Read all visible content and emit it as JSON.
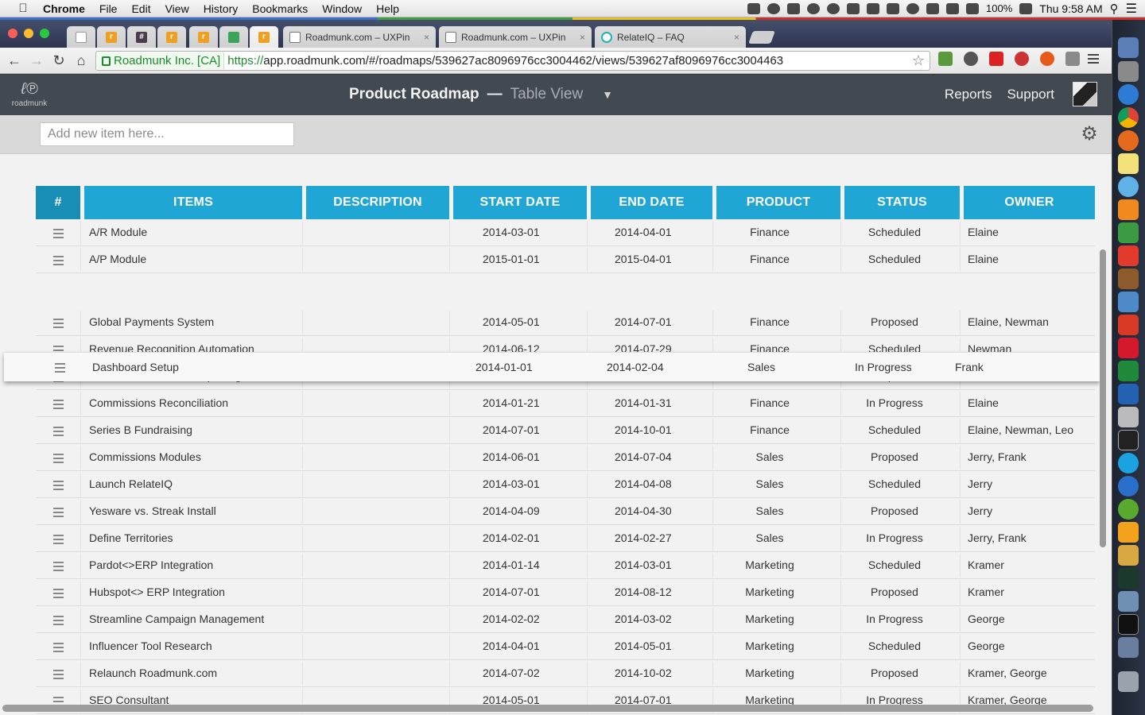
{
  "menubar": {
    "app": "Chrome",
    "items": [
      "File",
      "Edit",
      "View",
      "History",
      "Bookmarks",
      "Window",
      "Help"
    ],
    "battery": "100%",
    "clock": "Thu 9:58 AM"
  },
  "tabs": [
    {
      "label": "Roadmunk.com – UXPin",
      "close": "×"
    },
    {
      "label": "Roadmunk.com – UXPin",
      "close": "×"
    },
    {
      "label": "RelateIQ – FAQ",
      "close": "×"
    }
  ],
  "pinned_favicons": [
    "#",
    "r"
  ],
  "omnibox": {
    "ev_label": "Roadmunk Inc. [CA]",
    "protocol": "https://",
    "url": "app.roadmunk.com/#/roadmaps/539627ac8096976cc3004462/views/539627af8096976cc3004463"
  },
  "app": {
    "logo_text": "roadmunk",
    "title": "Product Roadmap",
    "dash": "—",
    "view": "Table View",
    "nav": [
      "Reports",
      "Support"
    ],
    "add_placeholder": "Add new item here..."
  },
  "table": {
    "columns": [
      "#",
      "ITEMS",
      "DESCRIPTION",
      "START DATE",
      "END DATE",
      "PRODUCT",
      "STATUS",
      "OWNER"
    ],
    "rows_top": [
      {
        "item": "A/R Module",
        "start": "2014-03-01",
        "end": "2014-04-01",
        "product": "Finance",
        "status": "Scheduled",
        "owner": "Elaine"
      },
      {
        "item": "A/P Module",
        "start": "2015-01-01",
        "end": "2015-04-01",
        "product": "Finance",
        "status": "Scheduled",
        "owner": "Elaine"
      }
    ],
    "dragging": {
      "item": "Dashboard Setup",
      "start": "2014-01-01",
      "end": "2014-02-04",
      "product": "Sales",
      "status": "In Progress",
      "owner": "Frank"
    },
    "rows": [
      {
        "item": "Global Payments System",
        "start": "2014-05-01",
        "end": "2014-07-01",
        "product": "Finance",
        "status": "Proposed",
        "owner": "Elaine,  Newman"
      },
      {
        "item": "Revenue Recognition Automation",
        "start": "2014-06-12",
        "end": "2014-07-29",
        "product": "Finance",
        "status": "Scheduled",
        "owner": "Newman"
      },
      {
        "item": "Streamline Financial Reporting",
        "start": "2014-02-13",
        "end": "2014-04-01",
        "product": "Finance",
        "status": "Proposed",
        "owner": "Elaine,  Newman"
      },
      {
        "item": "Commissions Reconciliation",
        "start": "2014-01-21",
        "end": "2014-01-31",
        "product": "Finance",
        "status": "In Progress",
        "owner": "Elaine"
      },
      {
        "item": "Series B Fundraising",
        "start": "2014-07-01",
        "end": "2014-10-01",
        "product": "Finance",
        "status": "Scheduled",
        "owner": "Elaine,  Newman,  Leo"
      },
      {
        "item": "Commissions Modules",
        "start": "2014-06-01",
        "end": "2014-07-04",
        "product": "Sales",
        "status": "Proposed",
        "owner": "Jerry,  Frank"
      },
      {
        "item": "Launch RelateIQ",
        "start": "2014-03-01",
        "end": "2014-04-08",
        "product": "Sales",
        "status": "Scheduled",
        "owner": "Jerry"
      },
      {
        "item": "Yesware vs. Streak Install",
        "start": "2014-04-09",
        "end": "2014-04-30",
        "product": "Sales",
        "status": "Proposed",
        "owner": "Jerry"
      },
      {
        "item": "Define Territories",
        "start": "2014-02-01",
        "end": "2014-02-27",
        "product": "Sales",
        "status": "In Progress",
        "owner": "Jerry,  Frank"
      },
      {
        "item": "Pardot<>ERP Integration",
        "start": "2014-01-14",
        "end": "2014-03-01",
        "product": "Marketing",
        "status": "Scheduled",
        "owner": "Kramer"
      },
      {
        "item": "Hubspot<> ERP Integration",
        "start": "2014-07-01",
        "end": "2014-08-12",
        "product": "Marketing",
        "status": "Proposed",
        "owner": "Kramer"
      },
      {
        "item": "Streamline Campaign Management",
        "start": "2014-02-02",
        "end": "2014-03-02",
        "product": "Marketing",
        "status": "In Progress",
        "owner": "George"
      },
      {
        "item": "Influencer Tool Research",
        "start": "2014-04-01",
        "end": "2014-05-01",
        "product": "Marketing",
        "status": "Scheduled",
        "owner": "George"
      },
      {
        "item": "Relaunch Roadmunk.com",
        "start": "2014-07-02",
        "end": "2014-10-02",
        "product": "Marketing",
        "status": "Proposed",
        "owner": "Kramer,  George"
      },
      {
        "item": "SEO Consultant",
        "start": "2014-05-01",
        "end": "2014-07-01",
        "product": "Marketing",
        "status": "In Progress",
        "owner": "Kramer,  George"
      }
    ]
  },
  "colors": {
    "header_blue": "#1fa6d4",
    "hash_blue": "#188db6",
    "appbar": "#434950"
  }
}
